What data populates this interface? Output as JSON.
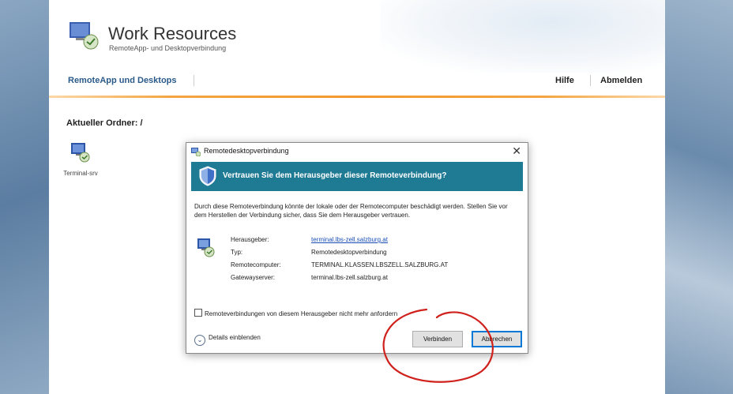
{
  "app": {
    "title": "Work Resources",
    "subtitle": "RemoteApp- und Desktopverbindung"
  },
  "nav": {
    "left": "RemoteApp und Desktops",
    "help": "Hilfe",
    "logout": "Abmelden"
  },
  "folder": {
    "label": "Aktueller Ordner: /"
  },
  "resources": [
    {
      "label": "Terminal-srv",
      "icon": "remote-desktop-icon"
    }
  ],
  "dialog": {
    "title": "Remotedesktopverbindung",
    "banner": "Vertrauen Sie dem Herausgeber dieser Remoteverbindung?",
    "intro": "Durch diese Remoteverbindung könnte der lokale oder der Remotecomputer beschädigt werden. Stellen Sie vor dem Herstellen der Verbindung sicher, dass Sie dem Herausgeber vertrauen.",
    "fields": [
      {
        "key": "Herausgeber:",
        "value": "terminal.lbs-zell.salzburg.at",
        "link": true
      },
      {
        "key": "Typ:",
        "value": "Remotedesktopverbindung",
        "link": false
      },
      {
        "key": "Remotecomputer:",
        "value": "TERMINAL.KLASSEN.LBSZELL.SALZBURG.AT",
        "link": false
      },
      {
        "key": "Gatewayserver:",
        "value": "terminal.lbs-zell.salzburg.at",
        "link": false
      }
    ],
    "checkbox_label": "Remoteverbindungen von diesem Herausgeber nicht mehr anfordern",
    "details_label": "Details einblenden",
    "connect_label": "Verbinden",
    "cancel_label": "Abbrechen",
    "close_glyph": "✕"
  },
  "colors": {
    "banner": "#1f7a94",
    "nav_accent": "#f39a2c",
    "annotation": "#d0211c"
  }
}
